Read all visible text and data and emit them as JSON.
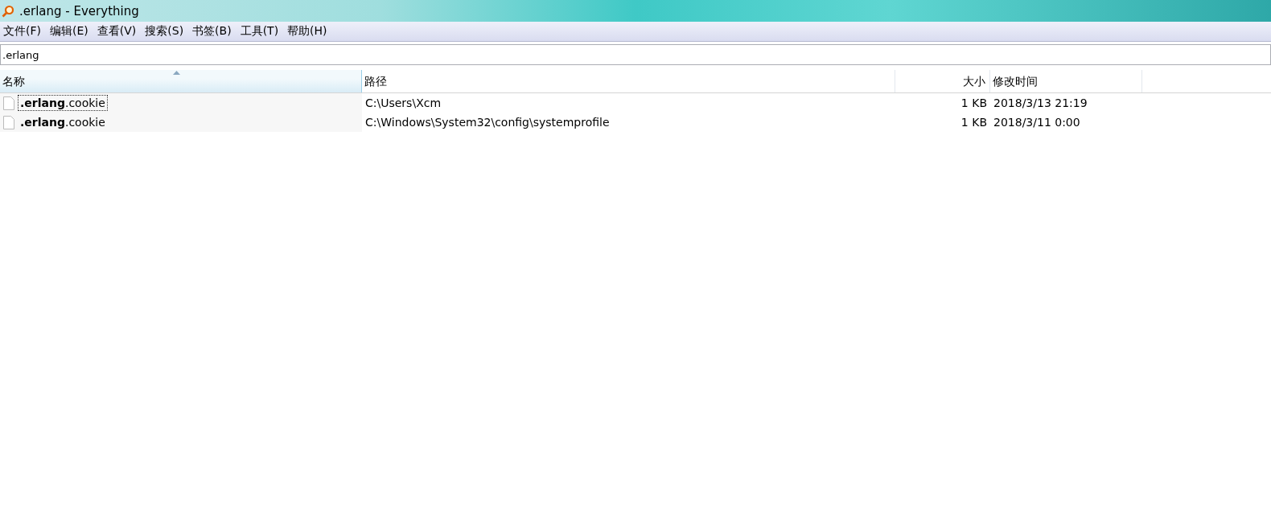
{
  "window": {
    "title": ".erlang - Everything"
  },
  "menu": [
    "文件(F)",
    "编辑(E)",
    "查看(V)",
    "搜索(S)",
    "书签(B)",
    "工具(T)",
    "帮助(H)"
  ],
  "search": {
    "value": ".erlang"
  },
  "table": {
    "columns": [
      {
        "label": "名称",
        "sorted": true
      },
      {
        "label": "路径",
        "sorted": false
      },
      {
        "label": "大小",
        "sorted": false
      },
      {
        "label": "修改时间",
        "sorted": false
      }
    ],
    "rows": [
      {
        "name": "**.erlang**.cookie",
        "path": "C:\\Users\\Xcm",
        "size": "1 KB",
        "modified": "2018/3/13 21:19",
        "focused": true
      },
      {
        "name": "**.erlang**.cookie",
        "path": "C:\\Windows\\System32\\config\\systemprofile",
        "size": "1 KB",
        "modified": "2018/3/11 0:00",
        "focused": false
      }
    ]
  }
}
